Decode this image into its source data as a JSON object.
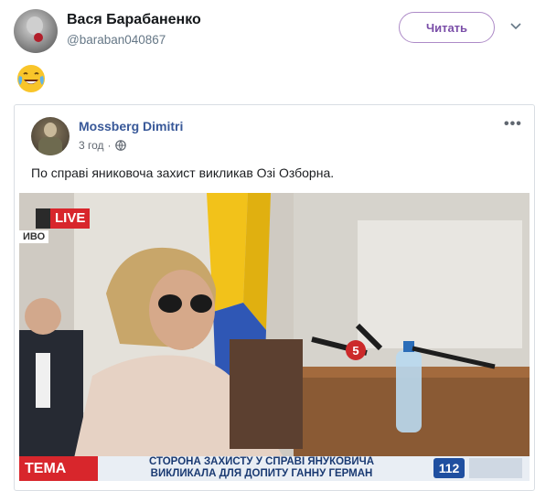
{
  "tweet": {
    "author_name": "Вася Барабаненко",
    "author_handle": "@baraban040867",
    "follow_label": "Читать",
    "caret_icon": "chevron-down-icon",
    "emoji_icon": "face-with-tears-of-joy-icon"
  },
  "embed": {
    "author_name": "Mossberg Dimitri",
    "time": "3 год",
    "separator": "·",
    "privacy_icon": "globe-icon",
    "more_icon": "more-options-icon",
    "text": "По справі яниковоча захист викликав Озі Озборна.",
    "photo": {
      "live_label": "LIVE",
      "live_sub": "ИВО",
      "ticker_tag": "ТЕМА",
      "ticker_line1": "СТОРОНА ЗАХИСТУ У СПРАВІ ЯНУКОВИЧА",
      "ticker_line2": "ВИКЛИКАЛА ДЛЯ ДОПИТУ ГАННУ ГЕРМАН",
      "channel_number": "112",
      "mic_label": "5"
    }
  },
  "colors": {
    "follow_border": "#ad8ac7",
    "follow_text": "#7a4ea8",
    "fb_name": "#385898",
    "live_red": "#d8262c",
    "ticker_blue": "#1a3a72"
  }
}
